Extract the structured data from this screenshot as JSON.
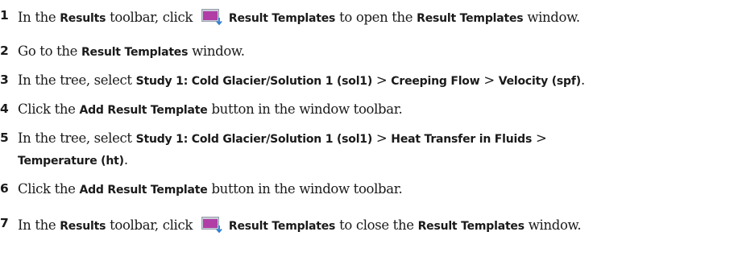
{
  "steps": [
    {
      "num": "1",
      "t1": "In the ",
      "b1": "Results",
      "t2": " toolbar, click ",
      "icon": "result-templates-icon",
      "b2": "Result Templates",
      "t3": " to open the ",
      "b3": "Result Templates",
      "t4": " window."
    },
    {
      "num": "2",
      "t1": "Go to the ",
      "b1": "Result Templates",
      "t2": " window."
    },
    {
      "num": "3",
      "t1": "In the tree, select ",
      "b1": "Study 1: Cold Glacier/Solution 1 (sol1)",
      "t2": " > ",
      "b2": "Creeping Flow",
      "t3": " > ",
      "b3": "Velocity (spf)",
      "t4": "."
    },
    {
      "num": "4",
      "t1": "Click the ",
      "b1": "Add Result Template",
      "t2": " button in the window toolbar."
    },
    {
      "num": "5",
      "t1": "In the tree, select ",
      "b1": "Study 1: Cold Glacier/Solution 1 (sol1)",
      "t2": " > ",
      "b2": "Heat Transfer in Fluids",
      "t3": " >",
      "line2_b1": "Temperature (ht)",
      "line2_t1": "."
    },
    {
      "num": "6",
      "t1": "Click the ",
      "b1": "Add Result Template",
      "t2": " button in the window toolbar."
    },
    {
      "num": "7",
      "t1": "In the ",
      "b1": "Results",
      "t2": " toolbar, click ",
      "icon": "result-templates-icon",
      "b2": "Result Templates",
      "t3": " to close the ",
      "b3": "Result Templates",
      "t4": " window."
    }
  ],
  "colors": {
    "text": "#1a1a1a",
    "icon_fill": "#b03ea6",
    "icon_frame": "#c8ccd6",
    "icon_arrow": "#2f7fd1"
  }
}
